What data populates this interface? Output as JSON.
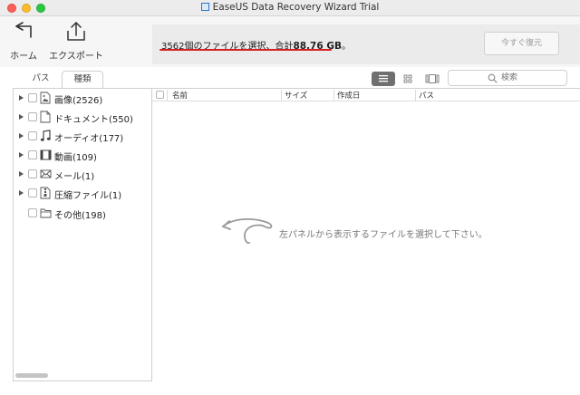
{
  "window": {
    "title": "EaseUS Data Recovery Wizard Trial"
  },
  "toolbar": {
    "home_label": "ホーム",
    "export_label": "エクスポート"
  },
  "status": {
    "prefix": "3562個のファイルを選択、合計",
    "size": "88.76 GB",
    "suffix": "。",
    "recover_label": "今すぐ復元"
  },
  "tabs": [
    {
      "label": "パス",
      "active": false
    },
    {
      "label": "種類",
      "active": true
    }
  ],
  "search": {
    "placeholder": "検索"
  },
  "tree": [
    {
      "label": "画像(2526)",
      "icon": "image-file-icon",
      "expandable": true
    },
    {
      "label": "ドキュメント(550)",
      "icon": "document-icon",
      "expandable": true
    },
    {
      "label": "オーディオ(177)",
      "icon": "music-note-icon",
      "expandable": true
    },
    {
      "label": "動画(109)",
      "icon": "film-icon",
      "expandable": true
    },
    {
      "label": "メール(1)",
      "icon": "mail-icon",
      "expandable": true
    },
    {
      "label": "圧縮ファイル(1)",
      "icon": "archive-icon",
      "expandable": true
    },
    {
      "label": "その他(198)",
      "icon": "folder-icon",
      "expandable": false
    }
  ],
  "columns": {
    "name": "名前",
    "size": "サイズ",
    "created": "作成日",
    "path": "パス"
  },
  "empty_message": "左パネルから表示するファイルを選択して下さい。",
  "colors": {
    "underline": "#d42020",
    "active_view": "#707070"
  }
}
